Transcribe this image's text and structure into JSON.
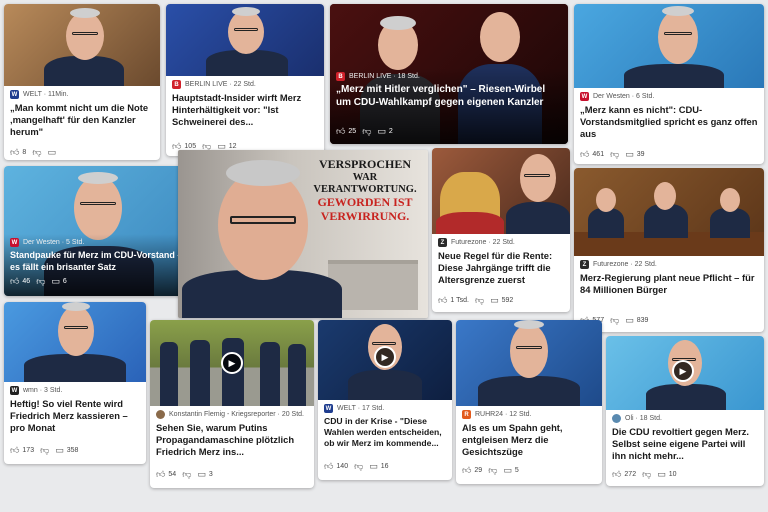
{
  "feed": {
    "cards": [
      {
        "source": "WELT · 11Min.",
        "title": "„Man kommt nicht um die Note ‚mangelhaft' für den Kanzler herum\"",
        "likes": "8",
        "dislike": "",
        "comments": ""
      },
      {
        "source": "BERLIN LIVE · 22 Std.",
        "title": "Hauptstadt-Insider wirft Merz Hinterhältigkeit vor: \"Ist Schweinerei des...",
        "likes": "105",
        "comments": "12"
      },
      {
        "source": "BERLIN LIVE · 18 Std.",
        "title": "„Merz mit Hitler verglichen\" – Riesen-Wirbel um CDU-Wahlkampf gegen eigenen Kanzler",
        "likes": "25",
        "comments": "2"
      },
      {
        "source": "Der Westen · 6 Std.",
        "title": "„Merz kann es nicht\": CDU-Vorstandsmitglied spricht es ganz offen aus",
        "likes": "461",
        "comments": "39"
      },
      {
        "source": "Der Westen · 5 Std.",
        "title": "Standpauke für Merz im CDU-Vorstand – es fällt ein brisanter Satz",
        "likes": "46",
        "comments": "6"
      },
      {
        "source": "Futurezone · 22 Std.",
        "title": "Neue Regel für die Rente: Diese Jahrgänge trifft die Altersgrenze zuerst",
        "likes": "1 Tsd.",
        "comments": "592"
      },
      {
        "source": "Futurezone · 22 Std.",
        "title": "Merz-Regierung plant neue Pflicht – für 84 Millionen Bürger",
        "likes": "577",
        "comments": "839"
      },
      {
        "source": "wmn · 3 Std.",
        "title": "Heftig! So viel Rente wird Friedrich Merz kassieren – pro Monat",
        "likes": "173",
        "comments": "358"
      },
      {
        "source": "Konstantin Flemig - Kriegsreporter · 20 Std.",
        "title": "Sehen Sie, warum Putins Propagandamaschine plötzlich Friedrich Merz ins...",
        "likes": "54",
        "comments": "3"
      },
      {
        "source": "WELT · 17 Std.",
        "title": "CDU in der Krise - \"Diese Wahlen werden entscheiden, ob wir Merz im kommende...",
        "likes": "140",
        "comments": "16"
      },
      {
        "source": "RUHR24 · 12 Std.",
        "title": "Als es um Spahn geht, entgleisen Merz die Gesichtszüge",
        "likes": "29",
        "comments": "5"
      },
      {
        "source": "Oli · 18 Std.",
        "title": "Die CDU revoltiert gegen Merz. Selbst seine eigene Partei will ihn nicht mehr...",
        "likes": "272",
        "comments": "10"
      }
    ],
    "poster": {
      "line1": "VERSPROCHEN",
      "line2": "WAR VERANTWORTUNG.",
      "line3": "GEWORDEN IST",
      "line4": "VERWIRRUNG."
    }
  },
  "icons": {
    "like": "thumbs-up-icon",
    "dislike": "thumbs-down-icon",
    "comment": "comment-icon",
    "play": "play-icon"
  },
  "colors": {
    "welt": "#1f3d8f",
    "berlin_live": "#d0202a",
    "der_westen": "#c8102e",
    "futurezone": "#2b2b2b",
    "wmn": "#222222",
    "ruhr24": "#e25a1c",
    "poster_red": "#c8231f"
  }
}
